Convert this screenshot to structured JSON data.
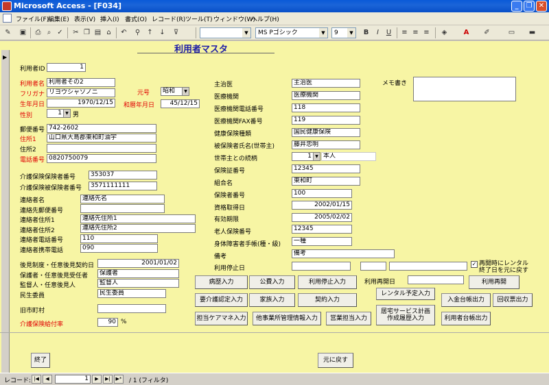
{
  "app": {
    "title": "Microsoft Access - [F034]",
    "min": "_",
    "max": "❐",
    "close": "✕"
  },
  "menu": [
    "ファイル(F)",
    "編集(E)",
    "表示(V)",
    "挿入(I)",
    "書式(O)",
    "レコード(R)",
    "ツール(T)",
    "ウィンドウ(W)",
    "ヘルプ(H)"
  ],
  "toolbar": {
    "font": "MS Pゴシック",
    "size": "9",
    "bold": "B",
    "italic": "I",
    "underline": "U"
  },
  "form": {
    "title": "利用者マスタ",
    "left": {
      "id_label": "利用者ID",
      "id_value": "1",
      "name_label": "利用者名",
      "name_value": "利用者その2",
      "kana_label": "フリガナ",
      "kana_value": "リヨウシャソノニ",
      "era_label": "元号",
      "era_value": "昭和",
      "birth_label": "生年月日",
      "birth_value": "1970/12/15",
      "jbirth_label": "和暦年月日",
      "jbirth_value": "45/12/15",
      "sex_label": "性別",
      "sex_code": "1",
      "sex_value": "男",
      "zip_label": "郵便番号",
      "zip_value": "742-2602",
      "addr1_label": "住所1",
      "addr1_value": "山口県大島郡東和町油宇",
      "addr2_label": "住所2",
      "addr2_value": "",
      "tel_label": "電話番号",
      "tel_value": "0820750079",
      "ins_label": "介護保険保険者番号",
      "ins_value": "353037",
      "insd_label": "介護保険被保険者番号",
      "insd_value": "3571111111",
      "contact_label": "連絡者名",
      "contact_value": "連絡先名",
      "czip_label": "連絡先郵便番号",
      "czip_value": "",
      "caddr1_label": "連絡者住所1",
      "caddr1_value": "連絡先住所1",
      "caddr2_label": "連絡者住所2",
      "caddr2_value": "連絡先住所2",
      "ctel_label": "連絡者電話番号",
      "ctel_value": "110",
      "cmob_label": "連絡者携帯電話",
      "cmob_value": "090",
      "guard_date_label": "後見制度・任意後見契約日",
      "guard_date_value": "2001/01/02",
      "guard_label": "保護者・任意後見受任者",
      "guard_value": "保護者",
      "sup_label": "監督人・任意後見人",
      "sup_value": "監督人",
      "min_label": "民生委員",
      "min_value": "民生委員",
      "old_label": "旧市町村",
      "old_value": "",
      "rate_label": "介護保険給付率",
      "rate_value": "90",
      "rate_unit": "%"
    },
    "mid": {
      "doc_label": "主治医",
      "doc_value": "主治医",
      "hosp_label": "医療機関",
      "hosp_value": "医療機関",
      "htel_label": "医療機関電話番号",
      "htel_value": "118",
      "hfax_label": "医療機関FAX番号",
      "hfax_value": "119",
      "hins_label": "健康保険種類",
      "hins_value": "国民健康保険",
      "head_label": "被保険者氏名(世帯主)",
      "head_value": "藤井忠明",
      "rel_label": "世帯主との続柄",
      "rel_code": "1",
      "rel_value": "本人",
      "card_label": "保険証番号",
      "card_value": "12345",
      "union_label": "組合名",
      "union_value": "東和町",
      "insr_label": "保険者番号",
      "insr_value": "100",
      "acq_label": "資格取得日",
      "acq_value": "2002/01/15",
      "exp_label": "有効期限",
      "exp_value": "2005/02/02",
      "elder_label": "老人保険番号",
      "elder_value": "12345",
      "dis_label": "身体障害者手帳(種・級)",
      "dis_value": "一種",
      "note_label": "備考",
      "note_value": "備考",
      "stop_label": "利用停止日",
      "stop_value": "",
      "resume_label": "利用再開日",
      "resume_value": ""
    },
    "memo_label": "メモ書き",
    "memo_value": "",
    "chk_label": "再開時にレンタル終了日を元に戻す",
    "buttons": {
      "history": "病歴入力",
      "public": "公費入力",
      "stop": "利用停止入力",
      "resume": "利用再開",
      "care": "要介護認定入力",
      "family": "家族入力",
      "contract": "契約入力",
      "rental": "レンタル予定入力",
      "deposit": "入金台帳出力",
      "collect": "回収票出力",
      "manager": "担当ケアマネ入力",
      "other": "他事業所管理情報入力",
      "staff": "営業担当入力",
      "plan": "居宅サービス計画作成履歴入力",
      "ledger": "利用者台帳出力",
      "finish": "終了",
      "back": "元に戻す"
    }
  },
  "nav": {
    "label": "レコード:",
    "current": "1",
    "total": "/ 1 (フィルタ)"
  }
}
